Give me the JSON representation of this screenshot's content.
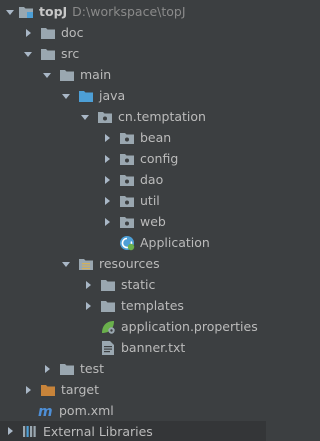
{
  "tree": {
    "project_name": "topJ",
    "project_path": "D:\\workspace\\topJ",
    "items": [
      {
        "label": "doc"
      },
      {
        "label": "src"
      },
      {
        "label": "main"
      },
      {
        "label": "java"
      },
      {
        "label": "cn.temptation"
      },
      {
        "label": "bean"
      },
      {
        "label": "config"
      },
      {
        "label": "dao"
      },
      {
        "label": "util"
      },
      {
        "label": "web"
      },
      {
        "label": "Application"
      },
      {
        "label": "resources"
      },
      {
        "label": "static"
      },
      {
        "label": "templates"
      },
      {
        "label": "application.properties"
      },
      {
        "label": "banner.txt"
      },
      {
        "label": "test"
      },
      {
        "label": "target"
      },
      {
        "label": "pom.xml"
      },
      {
        "label": "External Libraries"
      }
    ]
  },
  "colors": {
    "background": "#3c3f41",
    "text": "#bbbbbb",
    "folder": "#9aa7b0",
    "source_folder": "#4d9fd6",
    "resources_folder": "#d4b15a",
    "excluded_folder": "#c8843a",
    "spring_green": "#6ab04c",
    "maven_blue": "#4e8fd6"
  }
}
